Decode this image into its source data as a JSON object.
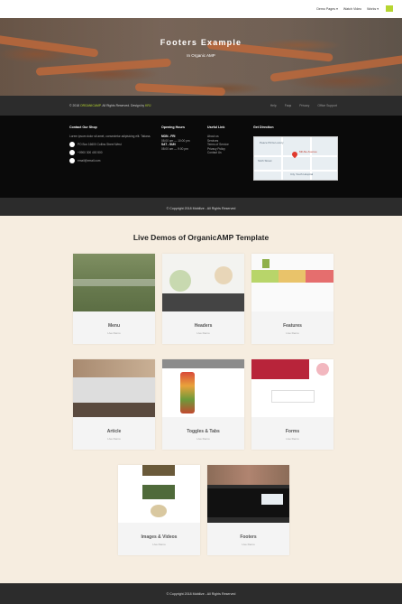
{
  "nav": {
    "items": [
      "Demo Pages ▾",
      "Watch Video",
      "Works ▾"
    ]
  },
  "hero": {
    "title": "Footers Example",
    "breadcrumb": "In Organic AMP"
  },
  "footer_bar": {
    "copyright_prefix": "© 2018",
    "brand": "ORGANICAMP",
    "copyright_mid": ". All Rights Reserved. Design by",
    "designer": "KRJ",
    "links": [
      "Help",
      "Faqs",
      "Privacy",
      "Office Support"
    ]
  },
  "footer_main": {
    "contact": {
      "heading": "Contact Our Shop",
      "text": "Lorem ipsum dolor sit amet, consectetur adipisicing elit. Tatiana.",
      "items": [
        "PO Box 16600 Collins Street West",
        "+0900 300 400 500",
        "email@email.com"
      ]
    },
    "hours": {
      "heading": "Opening Hours",
      "lines": [
        "MON - FRI",
        "08:00 am — 10:00 pm",
        "SAT - SUN",
        "08:00 am — 9:00 pm"
      ]
    },
    "useful": {
      "heading": "Useful Link",
      "links": [
        "About us",
        "Services",
        "Terms of Service",
        "Privacy Policy",
        "Contact Us"
      ]
    },
    "direction": {
      "heading": "Get Direction",
      "map_labels": [
        "Peace Pizza Luxury",
        "Sixth Street",
        "Mil Ale Avenue",
        "City Youth Hospital"
      ]
    }
  },
  "footer_copy": "© Copyright 2018 Mobilize - All Rights Reserved",
  "demos": {
    "title": "Live Demos of OrganicAMP Template",
    "cards": [
      {
        "name": "Menu",
        "sub": "Live Demo"
      },
      {
        "name": "Headers",
        "sub": "Live Demo"
      },
      {
        "name": "Features",
        "sub": "Live Demo"
      },
      {
        "name": "Article",
        "sub": "Live Demo"
      },
      {
        "name": "Toggles & Tabs",
        "sub": "Live Demo"
      },
      {
        "name": "Forms",
        "sub": "Live Demo"
      },
      {
        "name": "Images & Videos",
        "sub": "Live Demo"
      },
      {
        "name": "Footers",
        "sub": "Live Demo"
      }
    ]
  },
  "page_copy": "© Copyright 2018 Mobilize - All Rights Reserved",
  "colors": {
    "accent": "#b6d531",
    "page_bg": "#f6ede0",
    "dark": "#2c2c2c"
  }
}
